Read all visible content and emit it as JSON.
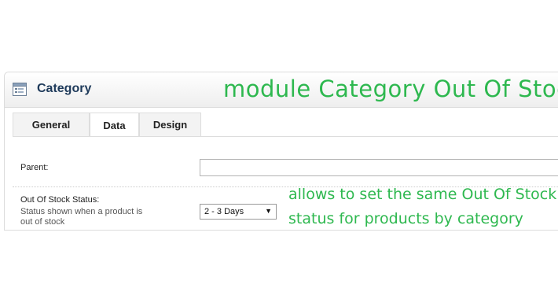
{
  "header": {
    "title": "Category",
    "promo_title": "module Category Out Of Stock"
  },
  "tabs": [
    {
      "label": "General"
    },
    {
      "label": "Data"
    },
    {
      "label": "Design"
    }
  ],
  "form": {
    "parent_label": "Parent:",
    "parent_value": "",
    "stock_label": "Out Of Stock Status:",
    "stock_help_line1": "Status shown when a product is",
    "stock_help_line2": "out of stock",
    "stock_value": "2 - 3 Days"
  },
  "note": {
    "line1": "allows to set the same Out Of Stock",
    "line2": "status for products by category"
  },
  "colors": {
    "accent_green": "#2eb84f",
    "title_blue": "#1f3b5b"
  }
}
